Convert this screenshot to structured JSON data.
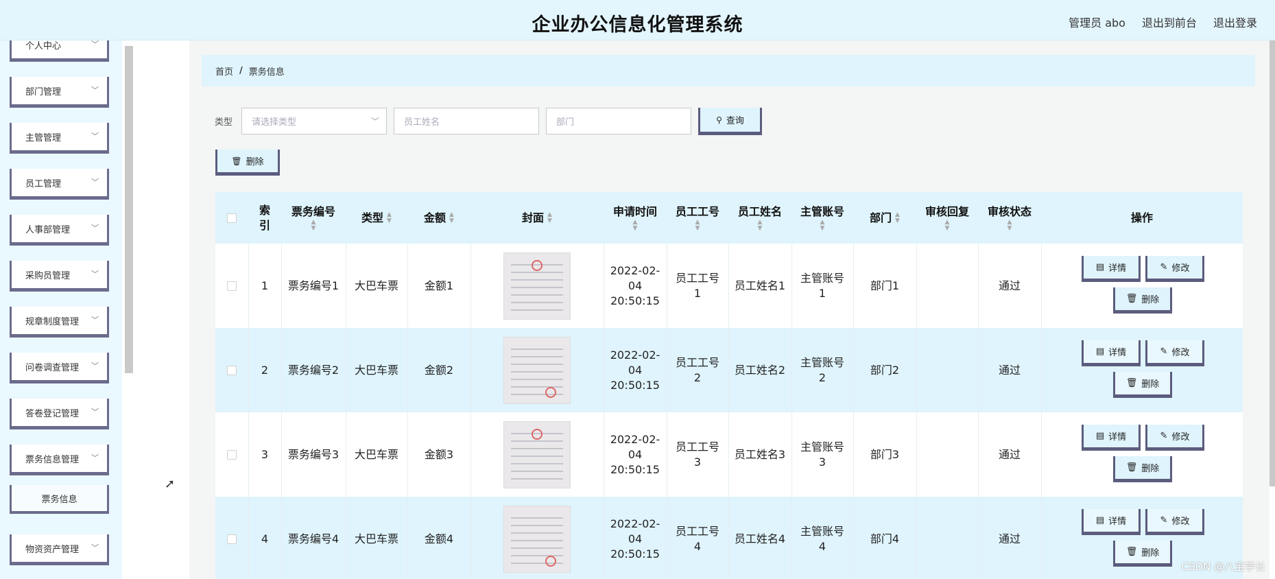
{
  "header": {
    "title": "企业办公信息化管理系统",
    "user_label": "管理员 abo",
    "front_link": "退出到前台",
    "logout_link": "退出登录"
  },
  "sidebar": {
    "items": [
      {
        "label": "个人中心"
      },
      {
        "label": "部门管理"
      },
      {
        "label": "主管管理"
      },
      {
        "label": "员工管理"
      },
      {
        "label": "人事部管理"
      },
      {
        "label": "采购员管理"
      },
      {
        "label": "规章制度管理"
      },
      {
        "label": "问卷调查管理"
      },
      {
        "label": "答卷登记管理"
      },
      {
        "label": "票务信息管理"
      },
      {
        "label": "票务信息"
      },
      {
        "label": "物资资产管理"
      }
    ]
  },
  "breadcrumb": {
    "home": "首页",
    "sep": "/",
    "current": "票务信息"
  },
  "filters": {
    "type_label": "类型",
    "type_placeholder": "请选择类型",
    "name_placeholder": "员工姓名",
    "dept_placeholder": "部门",
    "search_label": "查询"
  },
  "toolbar": {
    "delete_label": "删除"
  },
  "table": {
    "headers": {
      "index": "索引",
      "ticket_no": "票务编号",
      "type": "类型",
      "amount": "金额",
      "cover": "封面",
      "apply_time": "申请时间",
      "emp_id": "员工工号",
      "emp_name": "员工姓名",
      "manager": "主管账号",
      "dept": "部门",
      "reply": "审核回复",
      "status": "审核状态",
      "ops": "操作"
    },
    "rows": [
      {
        "index": "1",
        "ticket_no": "票务编号1",
        "type": "大巴车票",
        "amount": "金额1",
        "time": "2022-02-04 20:50:15",
        "emp_id": "员工工号1",
        "emp_name": "员工姓名1",
        "manager": "主管账号1",
        "dept": "部门1",
        "reply": "",
        "status": "通过"
      },
      {
        "index": "2",
        "ticket_no": "票务编号2",
        "type": "大巴车票",
        "amount": "金额2",
        "time": "2022-02-04 20:50:15",
        "emp_id": "员工工号2",
        "emp_name": "员工姓名2",
        "manager": "主管账号2",
        "dept": "部门2",
        "reply": "",
        "status": "通过"
      },
      {
        "index": "3",
        "ticket_no": "票务编号3",
        "type": "大巴车票",
        "amount": "金额3",
        "time": "2022-02-04 20:50:15",
        "emp_id": "员工工号3",
        "emp_name": "员工姓名3",
        "manager": "主管账号3",
        "dept": "部门3",
        "reply": "",
        "status": "通过"
      },
      {
        "index": "4",
        "ticket_no": "票务编号4",
        "type": "大巴车票",
        "amount": "金额4",
        "time": "2022-02-04 20:50:15",
        "emp_id": "员工工号4",
        "emp_name": "员工姓名4",
        "manager": "主管账号4",
        "dept": "部门4",
        "reply": "",
        "status": "通过"
      }
    ],
    "ops": {
      "detail": "详情",
      "edit": "修改",
      "delete": "删除"
    }
  },
  "watermark": "CSDN @八宝学长"
}
